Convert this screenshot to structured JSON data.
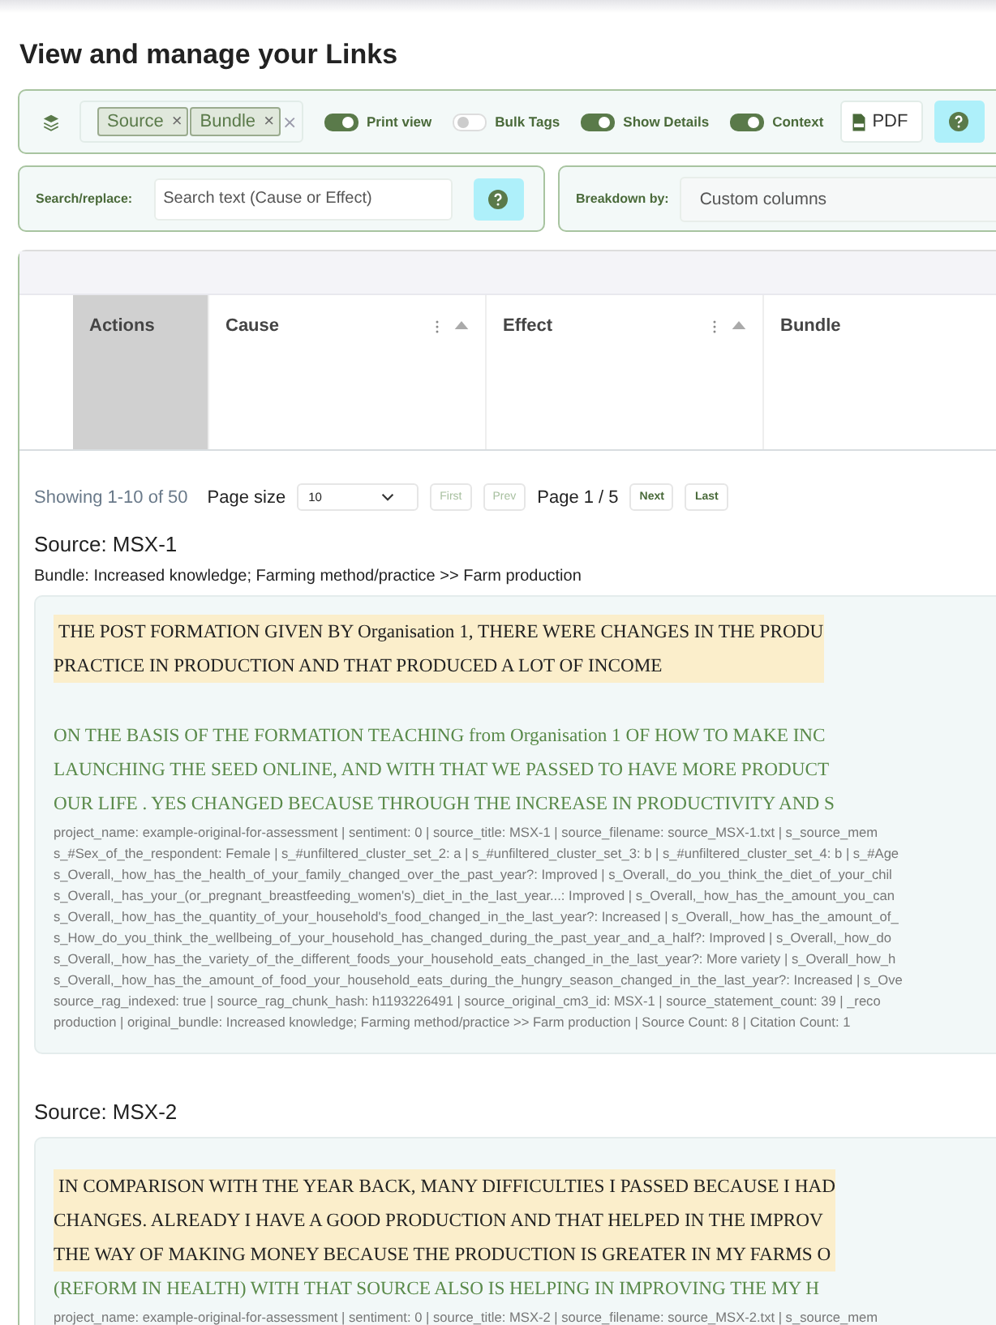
{
  "title": "View and manage your Links",
  "toolbar": {
    "tags": [
      {
        "label": "Source",
        "remove": "×"
      },
      {
        "label": "Bundle",
        "remove": "×"
      }
    ],
    "clear": "×",
    "toggles": [
      {
        "label": "Print view",
        "on": true
      },
      {
        "label": "Bulk Tags",
        "on": false
      },
      {
        "label": "Show Details",
        "on": true
      },
      {
        "label": "Context",
        "on": true
      }
    ],
    "pdf_button": "PDF"
  },
  "search": {
    "label": "Search/replace:",
    "placeholder": "Search text (Cause or Effect)"
  },
  "breakdown": {
    "label": "Breakdown by:",
    "value": "Custom columns"
  },
  "grid": {
    "columns": [
      {
        "label": "Actions",
        "selected": true,
        "kind": "plain"
      },
      {
        "label": "Cause",
        "selected": false,
        "kind": "sortable"
      },
      {
        "label": "Effect",
        "selected": false,
        "kind": "sortable"
      },
      {
        "label": "Bundle",
        "selected": false,
        "kind": "plain"
      }
    ]
  },
  "pagination": {
    "summary": "Showing 1-10 of 50",
    "page_size_label": "Page size",
    "page_size": "10",
    "page_label": "Page 1 / 5",
    "buttons": [
      {
        "label": "First",
        "disabled": true
      },
      {
        "label": "Prev",
        "disabled": true
      },
      {
        "label": "Next",
        "disabled": false
      },
      {
        "label": "Last",
        "disabled": false
      }
    ]
  },
  "sources": [
    {
      "title": "Source: MSX-1",
      "bundle": "Bundle: Increased knowledge; Farming method/practice >> Farm production",
      "highlight_lines": [
        "THE POST FORMATION GIVEN BY Organisation 1, THERE WERE CHANGES IN THE PRODU",
        "PRACTICE IN PRODUCTION AND THAT PRODUCED A LOT OF INCOME"
      ],
      "context_lines": [
        "ON THE BASIS OF THE FORMATION TEACHING from Organisation 1 OF HOW TO MAKE INC",
        "LAUNCHING THE SEED ONLINE, AND WITH THAT WE PASSED TO HAVE MORE PRODUCT",
        "OUR LIFE . YES CHANGED BECAUSE THROUGH THE INCREASE IN PRODUCTIVITY AND S"
      ],
      "meta_lines": [
        "project_name: example-original-for-assessment | sentiment: 0 | source_title: MSX-1 | source_filename: source_MSX-1.txt | s_source_mem",
        "s_#Sex_of_the_respondent: Female | s_#unfiltered_cluster_set_2: a | s_#unfiltered_cluster_set_3: b | s_#unfiltered_cluster_set_4: b | s_#Age",
        "s_Overall,_how_has_the_health_of_your_family_changed_over_the_past_year?: Improved | s_Overall,_do_you_think_the_diet_of_your_chil",
        "s_Overall,_has_your_(or_pregnant_breastfeeding_women's)_diet_in_the_last_year...: Improved | s_Overall,_how_has_the_amount_you_can",
        "s_Overall,_how_has_the_quantity_of_your_household's_food_changed_in_the_last_year?: Increased | s_Overall,_how_has_the_amount_of_",
        "s_How_do_you_think_the_wellbeing_of_your_household_has_changed_during_the_past_year_and_a_half?: Improved | s_Overall,_how_do",
        "s_Overall,_how_has_the_variety_of_the_different_foods_your_household_eats_changed_in_the_last_year?: More variety | s_Overall_how_h",
        "s_Overall,_how_has_the_amount_of_food_your_household_eats_during_the_hungry_season_changed_in_the_last_year?: Increased | s_Ove",
        "source_rag_indexed: true | source_rag_chunk_hash: h1193226491 | source_original_cm3_id: MSX-1 | source_statement_count: 39 | _reco",
        "production | original_bundle: Increased knowledge; Farming method/practice >> Farm production | Source Count: 8 | Citation Count: 1"
      ]
    },
    {
      "title": "Source: MSX-2",
      "highlight_lines": [
        "IN COMPARISON WITH THE YEAR BACK, MANY DIFFICULTIES I PASSED BECAUSE I HAD",
        "CHANGES. ALREADY I HAVE A GOOD PRODUCTION AND THAT HELPED IN THE IMPROV",
        "THE WAY OF MAKING MONEY BECAUSE THE PRODUCTION IS GREATER IN MY FARMS O"
      ],
      "context_lines": [
        "(REFORM IN HEALTH) WITH THAT SOURCE ALSO IS HELPING IN IMPROVING THE MY H"
      ],
      "meta_lines": [
        "project_name: example-original-for-assessment | sentiment: 0 | source_title: MSX-2 | source_filename: source_MSX-2.txt | s_source_mem"
      ]
    }
  ]
}
